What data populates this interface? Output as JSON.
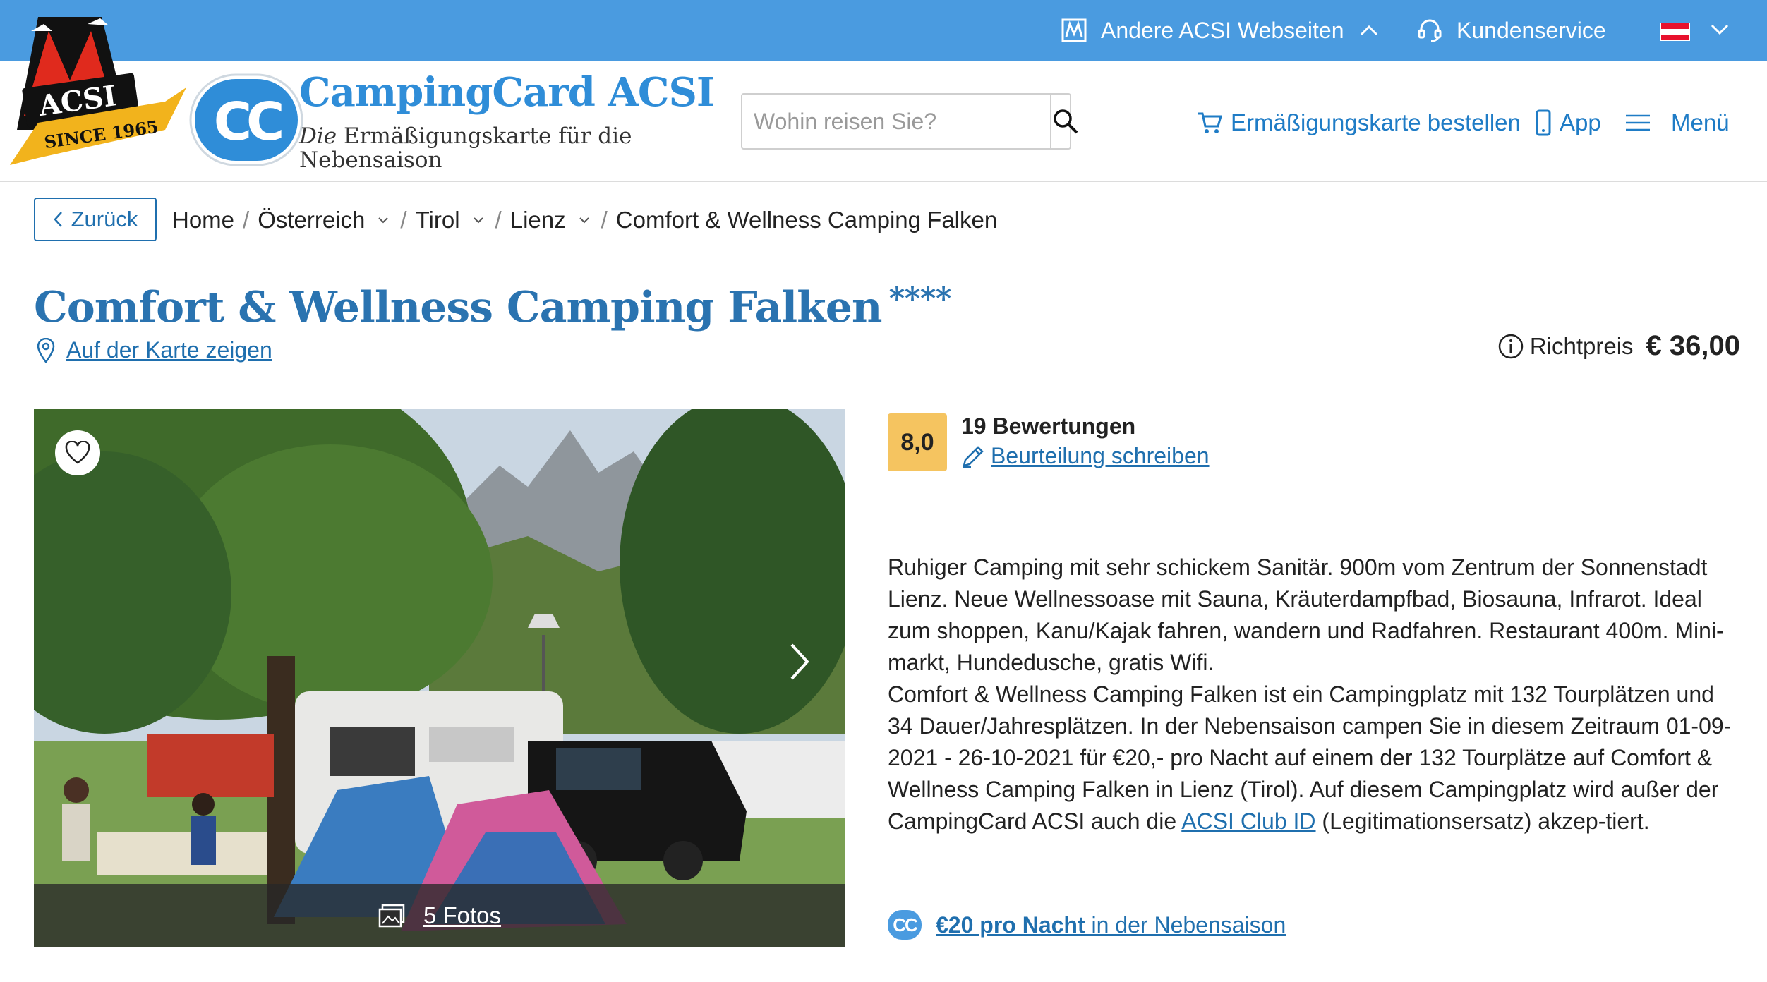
{
  "topbar": {
    "other_sites_label": "Andere ACSI Webseiten",
    "customer_service_label": "Kundenservice",
    "language_flag": "AT",
    "colors": {
      "bar": "#4a9be0",
      "flag_red": "#e8112d",
      "flag_white": "#ffffff"
    }
  },
  "brand": {
    "acsi_logo_text": "ACSI",
    "acsi_since_text": "SINCE 1965",
    "cc_logo_text": "CC",
    "name": "CampingCard ACSI",
    "tagline_em": "Die",
    "tagline_rest": " Ermäßigungskarte für die Nebensaison",
    "colors": {
      "primary": "#2f8dd8",
      "logo_red": "#e02a1d",
      "logo_gold": "#f2b31c"
    }
  },
  "search": {
    "placeholder": "Wohin reisen Sie?",
    "value": ""
  },
  "header_nav": {
    "order_card_label": "Ermäßigungskarte bestellen",
    "app_label": "App",
    "menu_label": "Menü"
  },
  "breadcrumb": {
    "back_label": "Zurück",
    "items": [
      {
        "label": "Home",
        "dropdown": false
      },
      {
        "label": "Österreich",
        "dropdown": true
      },
      {
        "label": "Tirol",
        "dropdown": true
      },
      {
        "label": "Lienz",
        "dropdown": true
      },
      {
        "label": "Comfort & Wellness Camping Falken",
        "dropdown": false
      }
    ]
  },
  "campsite": {
    "name": "Comfort & Wellness Camping Falken",
    "stars": "****",
    "map_link_label": "Auf der Karte zeigen",
    "price_label": "Richtpreis",
    "price_value": "€ 36,00",
    "photo_count_label": "5 Fotos",
    "rating": "8,0",
    "reviews_label": "19 Bewertungen",
    "write_review_label": "Beurteilung schreiben",
    "description_1": "Ruhiger Camping mit sehr schickem Sanitär. 900m vom Zentrum der Sonnenstadt Lienz. Neue Wellnessoase mit Sauna, Kräuterdampfbad, Biosauna, Infrarot. Ideal zum shoppen, Kanu/Kajak fahren, wandern und Radfahren. Restaurant 400m. Mini-markt, Hundedusche, gratis Wifi.",
    "description_2_before": "Comfort & Wellness Camping Falken ist ein Campingplatz mit 132 Tourplätzen und 34 Dauer/Jahresplätzen. In der Nebensaison campen Sie in diesem Zeitraum 01-09-2021 - 26-10-2021 für €20,- pro Nacht auf einem der 132 Tourplätze auf Comfort & Wellness Camping Falken in Lienz (Tirol). Auf diesem Campingplatz wird außer der CampingCard ACSI auch die ",
    "description_2_link": "ACSI Club ID",
    "description_2_after": " (Legitimationsersatz) akzep-tiert.",
    "offer_icon_text": "CC",
    "offer_bold": "€20 pro Nacht",
    "offer_rest": " in der Nebensaison",
    "colors": {
      "title": "#2a73b0",
      "link": "#1f6fae",
      "rating_badge": "#f5c460"
    }
  }
}
